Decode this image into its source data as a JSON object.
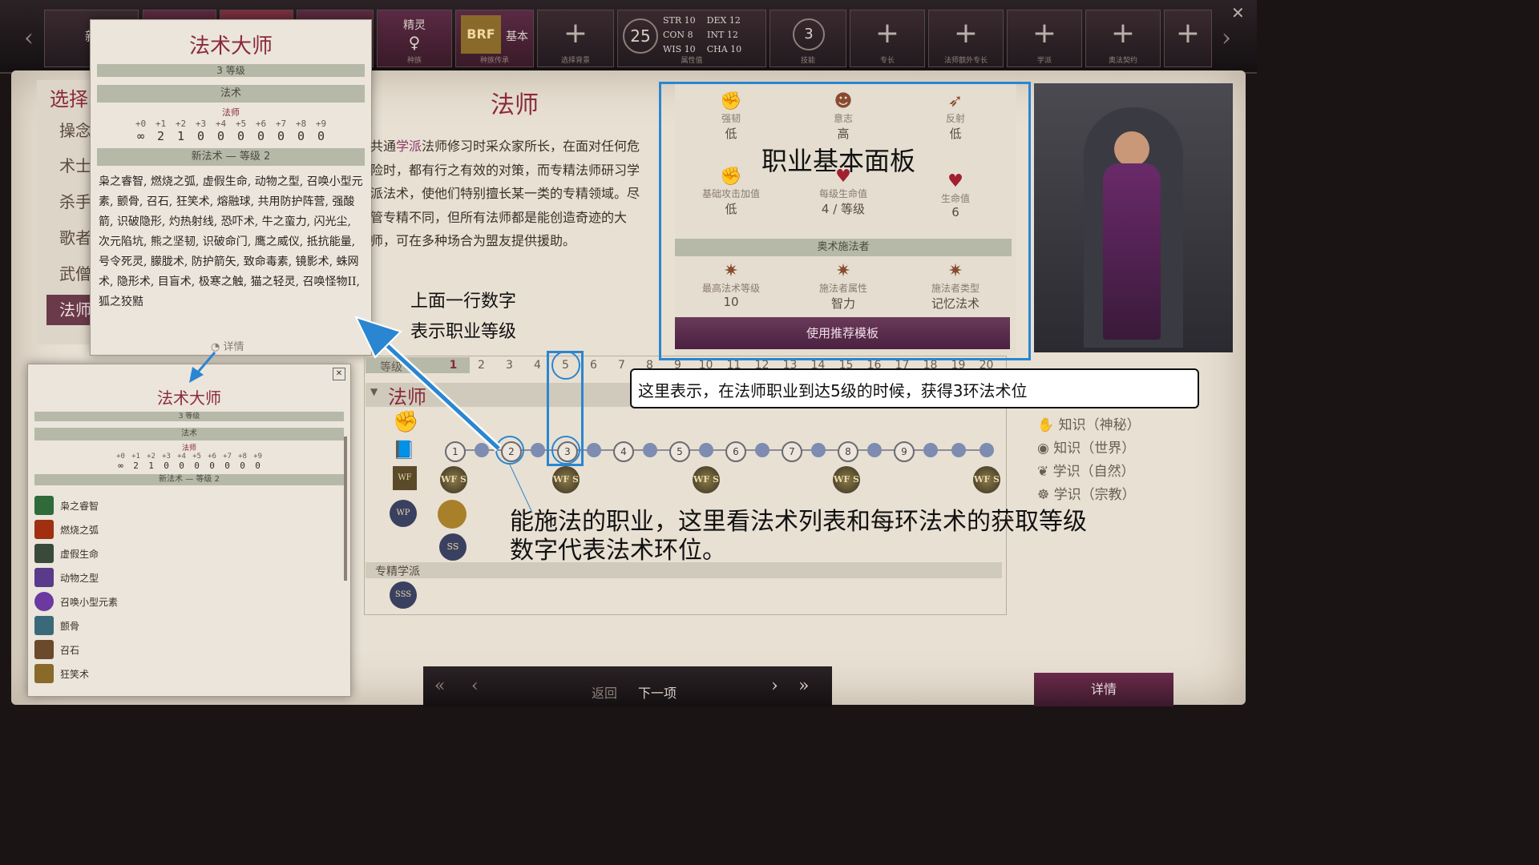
{
  "topbar": {
    "new_label": "新",
    "race_value": "精灵",
    "race_sub": "种族",
    "heritage_sub": "种族传承",
    "heritage_label": "基本",
    "background_sub": "选择背景",
    "points_value": "25",
    "attributes": [
      {
        "name": "STR",
        "value": "10"
      },
      {
        "name": "DEX",
        "value": "12"
      },
      {
        "name": "CON",
        "value": "8"
      },
      {
        "name": "INT",
        "value": "12"
      },
      {
        "name": "WIS",
        "value": "10"
      },
      {
        "name": "CHA",
        "value": "10"
      }
    ],
    "attributes_sub": "属性值",
    "skills_value": "3",
    "skills_sub": "技能",
    "slots_sub": [
      "专长",
      "法师额外专长",
      "学派",
      "奥法契约"
    ]
  },
  "sidebar": {
    "header": "选择",
    "classes": [
      "操念",
      "术士",
      "杀手",
      "歌者",
      "武僧",
      "法师"
    ]
  },
  "popup_top": {
    "title": "法术大师",
    "level_text": "3 等级",
    "section": "法术",
    "caster": "法师",
    "slot_headers": [
      "+0",
      "+1",
      "+2",
      "+3",
      "+4",
      "+5",
      "+6",
      "+7",
      "+8",
      "+9"
    ],
    "slot_values": [
      "∞",
      "2",
      "1",
      "0",
      "0",
      "0",
      "0",
      "0",
      "0",
      "0"
    ],
    "new_spells_header": "新法术 — 等级 2",
    "spell_text": "枭之睿智, 燃烧之弧, 虚假生命, 动物之型, 召唤小型元素, 颤骨, 召石, 狂笑术, 熔融球, 共用防护阵营, 强酸箭, 识破隐形, 灼热射线, 恐吓术, 牛之蛮力, 闪光尘, 次元陷坑, 熊之坚韧, 识破命门, 鹰之威仪, 抵抗能量, 号令死灵, 朦胧术, 防护箭矢, 致命毒素, 镜影术, 蛛网术, 隐形术, 目盲术, 极寒之触, 猫之轻灵, 召唤怪物II, 狐之狡黠",
    "details_label": "详情"
  },
  "popup_bottom": {
    "title": "法术大师",
    "level_text": "3 等级",
    "section": "法术",
    "caster": "法师",
    "slot_headers": [
      "+0",
      "+1",
      "+2",
      "+3",
      "+4",
      "+5",
      "+6",
      "+7",
      "+8",
      "+9"
    ],
    "slot_values": [
      "∞",
      "2",
      "1",
      "0",
      "0",
      "0",
      "0",
      "0",
      "0",
      "0"
    ],
    "new_spells_header": "新法术 — 等级 2",
    "spells": [
      {
        "name": "枭之睿智",
        "color": "#2e6a3a"
      },
      {
        "name": "燃烧之弧",
        "color": "#a03010"
      },
      {
        "name": "虚假生命",
        "color": "#3a4a3a"
      },
      {
        "name": "动物之型",
        "color": "#5a3a8a"
      },
      {
        "name": "召唤小型元素",
        "color": "#6a3aa0"
      },
      {
        "name": "颤骨",
        "color": "#3a6a7a"
      },
      {
        "name": "召石",
        "color": "#6a4a2a"
      },
      {
        "name": "狂笑术",
        "color": "#8a6a2a"
      }
    ]
  },
  "main": {
    "class_title": "法师",
    "description_prefix": "共通",
    "description_link": "学派",
    "description_rest": "法师修习时采众家所长，在面对任何危险时，都有行之有效的对策，而专精法师研习学派法术，使他们特别擅长某一类的专精领域。尽管专精不同，但所有法师都是能创造奇迹的大师，可在多种场合为盟友提供援助。"
  },
  "stat_panel": {
    "saves": [
      {
        "label": "强韧",
        "value": "低"
      },
      {
        "label": "意志",
        "value": "高"
      },
      {
        "label": "反射",
        "value": "低"
      }
    ],
    "bab_label": "基础攻击加值",
    "bab_value": "低",
    "hp_per_level_label": "每级生命值",
    "hp_per_level_value": "4 / 等级",
    "hp_label": "生命值",
    "hp_value": "6",
    "caster_header": "奥术施法者",
    "max_spell_label": "最高法术等级",
    "max_spell_value": "10",
    "caster_attr_label": "施法者属性",
    "caster_attr_value": "智力",
    "caster_type_label": "施法者类型",
    "caster_type_value": "记忆法术",
    "template_button": "使用推荐模板"
  },
  "progression": {
    "level_header": "等级",
    "levels": [
      "1",
      "2",
      "3",
      "4",
      "5",
      "6",
      "7",
      "8",
      "9",
      "10",
      "11",
      "12",
      "13",
      "14",
      "15",
      "16",
      "17",
      "18",
      "19",
      "20"
    ],
    "class_row_title": "法师",
    "spell_rings": [
      "1",
      "2",
      "3",
      "4",
      "5",
      "6",
      "7",
      "8",
      "9"
    ],
    "specialist_label": "专精学派",
    "medal_labels": [
      "WF",
      "WF S",
      "WF S",
      "WF S",
      "WF S",
      "WF S",
      "WP",
      "SS",
      "SSS"
    ]
  },
  "skills": [
    "知识（神秘）",
    "知识（世界）",
    "学识（自然）",
    "学识（宗教）"
  ],
  "footer": {
    "back_label": "返回",
    "next_label": "下一项",
    "details_button": "详情"
  },
  "annotations": {
    "panel_label": "职业基本面板",
    "top_row_line1": "上面一行数字",
    "top_row_line2": "表示职业等级",
    "level5_note": "这里表示，在法师职业到达5级的时候，获得3环法术位",
    "bottom_line1": "能施法的职业，这里看法术列表和每环法术的获取等级",
    "bottom_line2": "数字代表法术环位。"
  }
}
